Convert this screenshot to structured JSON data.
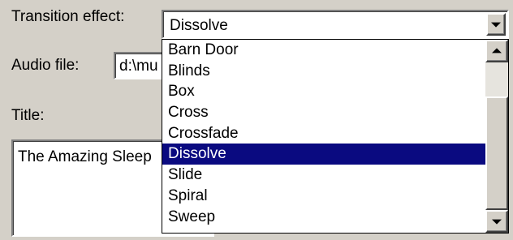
{
  "form": {
    "transition_label": "Transition effect:",
    "transition_value": "Dissolve",
    "audio_label": "Audio file:",
    "audio_value": "d:\\mu",
    "title_label": "Title:",
    "title_value": "The Amazing Sleep"
  },
  "dropdown": {
    "items": [
      "Barn Door",
      "Blinds",
      "Box",
      "Cross",
      "Crossfade",
      "Dissolve",
      "Slide",
      "Spiral",
      "Sweep"
    ],
    "selected_index": 5
  },
  "colors": {
    "dialog_bg": "#d4d0c8",
    "selection_bg": "#0a0a80",
    "selection_text": "#ffffff"
  },
  "icons": {
    "combo_button": "chevron-down-icon",
    "scroll_up": "chevron-up-icon",
    "scroll_down": "chevron-down-icon"
  }
}
